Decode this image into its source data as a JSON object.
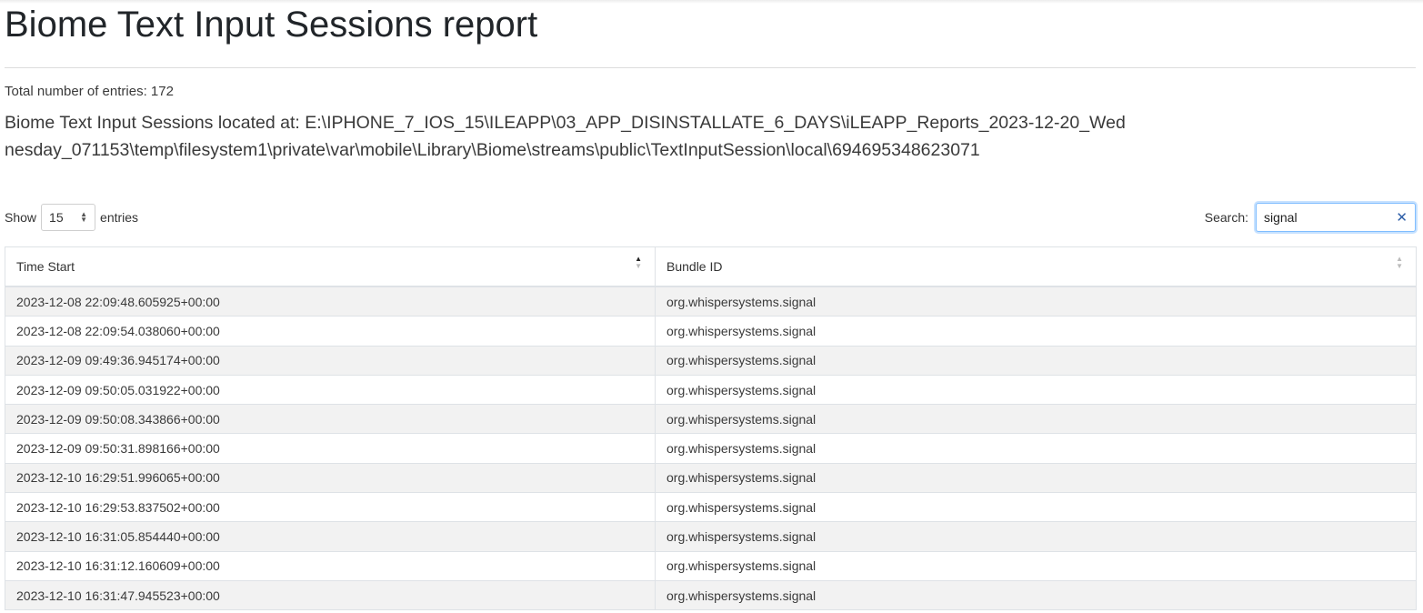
{
  "report": {
    "title": "Biome Text Input Sessions report",
    "total_entries": "Total number of entries: 172",
    "located_at": "Biome Text Input Sessions located at: E:\\IPHONE_7_IOS_15\\ILEAPP\\03_APP_DISINSTALLATE_6_DAYS\\iLEAPP_Reports_2023-12-20_Wednesday_071153\\temp\\filesystem1\\private\\var\\mobile\\Library\\Biome\\streams\\public\\TextInputSession\\local\\694695348623071"
  },
  "controls": {
    "show_label": "Show",
    "page_length": "15",
    "entries_label": "entries",
    "search_label": "Search:",
    "search_value": "signal"
  },
  "table": {
    "columns": [
      "Time Start",
      "Bundle ID"
    ],
    "sort": {
      "column": "Time Start",
      "direction": "ascending"
    },
    "rows": [
      [
        "2023-12-08 22:09:48.605925+00:00",
        "org.whispersystems.signal"
      ],
      [
        "2023-12-08 22:09:54.038060+00:00",
        "org.whispersystems.signal"
      ],
      [
        "2023-12-09 09:49:36.945174+00:00",
        "org.whispersystems.signal"
      ],
      [
        "2023-12-09 09:50:05.031922+00:00",
        "org.whispersystems.signal"
      ],
      [
        "2023-12-09 09:50:08.343866+00:00",
        "org.whispersystems.signal"
      ],
      [
        "2023-12-09 09:50:31.898166+00:00",
        "org.whispersystems.signal"
      ],
      [
        "2023-12-10 16:29:51.996065+00:00",
        "org.whispersystems.signal"
      ],
      [
        "2023-12-10 16:29:53.837502+00:00",
        "org.whispersystems.signal"
      ],
      [
        "2023-12-10 16:31:05.854440+00:00",
        "org.whispersystems.signal"
      ],
      [
        "2023-12-10 16:31:12.160609+00:00",
        "org.whispersystems.signal"
      ],
      [
        "2023-12-10 16:31:47.945523+00:00",
        "org.whispersystems.signal"
      ]
    ]
  },
  "icons": {
    "clear": "close-icon",
    "select_caret": "chevron-updown-icon",
    "sort": "sort-icon"
  },
  "colors": {
    "stripe": "#f2f2f2",
    "border": "#dee2e6",
    "focus": "#80bdff",
    "clear_icon": "#2f5fa8"
  }
}
